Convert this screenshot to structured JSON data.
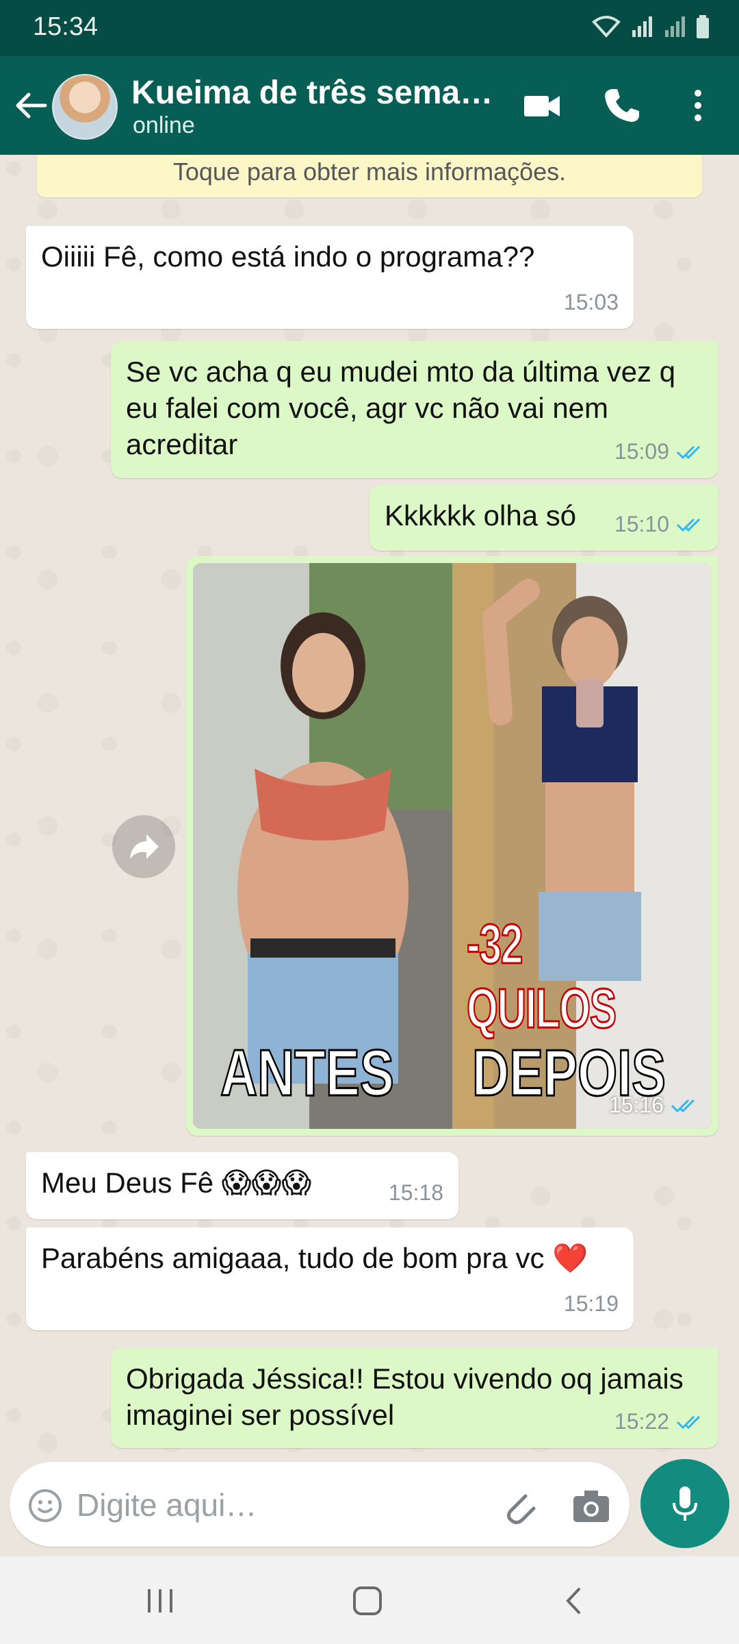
{
  "status_bar": {
    "time": "15:34"
  },
  "header": {
    "contact_name": "Kueima de três sema…",
    "status": "online"
  },
  "banner": "Toque para obter mais informações.",
  "messages": [
    {
      "dir": "in",
      "text": "Oiiiii Fê, como está indo o programa??",
      "time": "15:03"
    },
    {
      "dir": "out",
      "text": "Se vc acha q eu mudei mto da última vez q eu falei com você, agr vc não vai nem acreditar",
      "time": "15:09",
      "read": true
    },
    {
      "dir": "out",
      "text": "Kkkkkk olha só",
      "time": "15:10",
      "read": true
    },
    {
      "dir": "out",
      "type": "image",
      "time": "15:16",
      "read": true,
      "image_text": {
        "left": "ANTES",
        "right": "DEPOIS",
        "badge": "-32 QUILOS"
      }
    },
    {
      "dir": "in",
      "text": "Meu Deus Fê 😱😱😱",
      "time": "15:18"
    },
    {
      "dir": "in",
      "text": "Parabéns amigaaa, tudo de bom pra vc ❤️",
      "time": "15:19"
    },
    {
      "dir": "out",
      "text": "Obrigada Jéssica!! Estou vivendo oq jamais imaginei ser possível",
      "time": "15:22",
      "read": true
    }
  ],
  "input": {
    "placeholder": "Digite aqui…"
  },
  "colors": {
    "header": "#075e54",
    "status_bar": "#054d44",
    "outgoing": "#dcf8c6",
    "incoming": "#ffffff",
    "accent": "#128c7e",
    "read_ticks": "#34b7f1"
  },
  "icons": [
    "back-arrow-icon",
    "video-call-icon",
    "phone-icon",
    "more-vert-icon",
    "forward-icon",
    "emoji-icon",
    "attach-icon",
    "camera-icon",
    "mic-icon",
    "recents-icon",
    "home-icon",
    "nav-back-icon"
  ]
}
